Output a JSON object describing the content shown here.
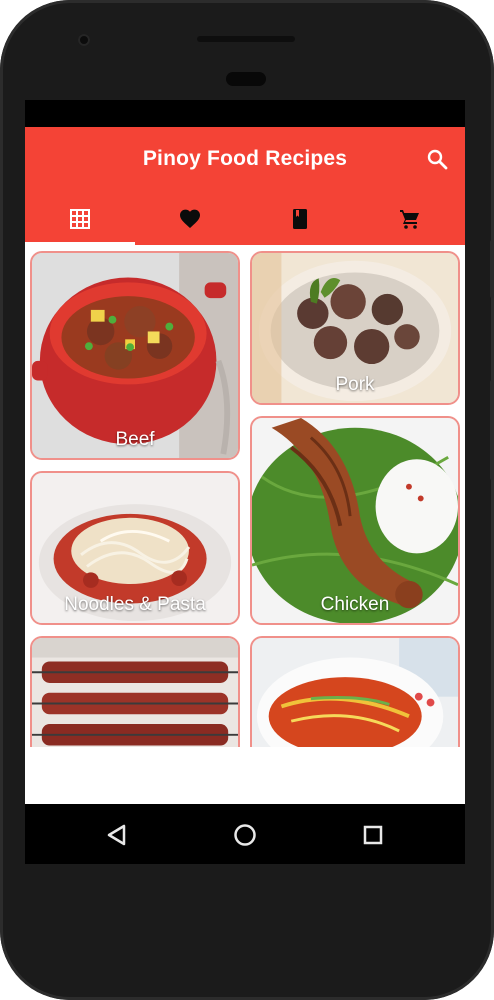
{
  "app": {
    "title": "Pinoy Food Recipes",
    "accent_color": "#f44336",
    "search_icon": "search-icon"
  },
  "tabs": [
    {
      "icon": "grid-icon",
      "selected": true
    },
    {
      "icon": "heart-icon",
      "selected": false
    },
    {
      "icon": "book-icon",
      "selected": false
    },
    {
      "icon": "cart-icon",
      "selected": false
    }
  ],
  "categories": [
    {
      "label": "Beef"
    },
    {
      "label": "Pork"
    },
    {
      "label": "Noodles & Pasta"
    },
    {
      "label": "Chicken"
    },
    {
      "label": ""
    },
    {
      "label": ""
    }
  ],
  "navigation": {
    "back_icon": "back-triangle-icon",
    "home_icon": "home-circle-icon",
    "recents_icon": "recents-square-icon"
  }
}
